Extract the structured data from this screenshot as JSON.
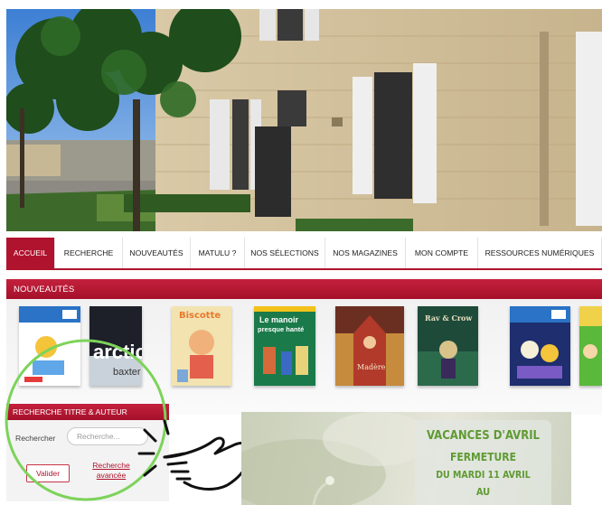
{
  "nav": {
    "items": [
      {
        "label": "ACCUEIL",
        "active": true
      },
      {
        "label": "RECHERCHE",
        "active": false
      },
      {
        "label": "NOUVEAUTÉS",
        "active": false
      },
      {
        "label": "MATULU ?",
        "active": false
      },
      {
        "label": "NOS SÉLECTIONS",
        "active": false
      },
      {
        "label": "NOS MAGAZINES",
        "active": false
      },
      {
        "label": "MON COMPTE",
        "active": false
      },
      {
        "label": "RESSOURCES NUMÉRIQUES",
        "active": false
      }
    ]
  },
  "colors": {
    "accent": "#b0132d",
    "highlight_ring": "#7dd35a",
    "announce_text": "#5f9a33"
  },
  "news": {
    "title": "NOUVEAUTÉS",
    "covers": [
      {
        "name": "cover-magazine-1",
        "title": ""
      },
      {
        "name": "cover-arctic",
        "title": "arctic",
        "subtitle": "baxter"
      },
      {
        "name": "cover-biscotte",
        "title": "Biscotte"
      },
      {
        "name": "cover-manoir",
        "title": "Le manoir presque hanté"
      },
      {
        "name": "cover-madere",
        "title": "Madère"
      },
      {
        "name": "cover-raven",
        "title": "Rav & Crow"
      },
      {
        "name": "cover-magazine-2",
        "title": ""
      },
      {
        "name": "cover-partial",
        "title": ""
      }
    ]
  },
  "search": {
    "title": "RECHERCHE TITRE & AUTEUR",
    "label": "Rechercher",
    "placeholder": "Recherche...",
    "submit_label": "Valider",
    "advanced_label": "Recherche avancée"
  },
  "announcement": {
    "line1": "VACANCES D'AVRIL",
    "line2": "FERMETURE",
    "line3": "DU MARDI 11 AVRIL",
    "line4": "AU"
  },
  "icons": {
    "hand": "pointing-hand-icon",
    "ring": "highlight-circle"
  }
}
